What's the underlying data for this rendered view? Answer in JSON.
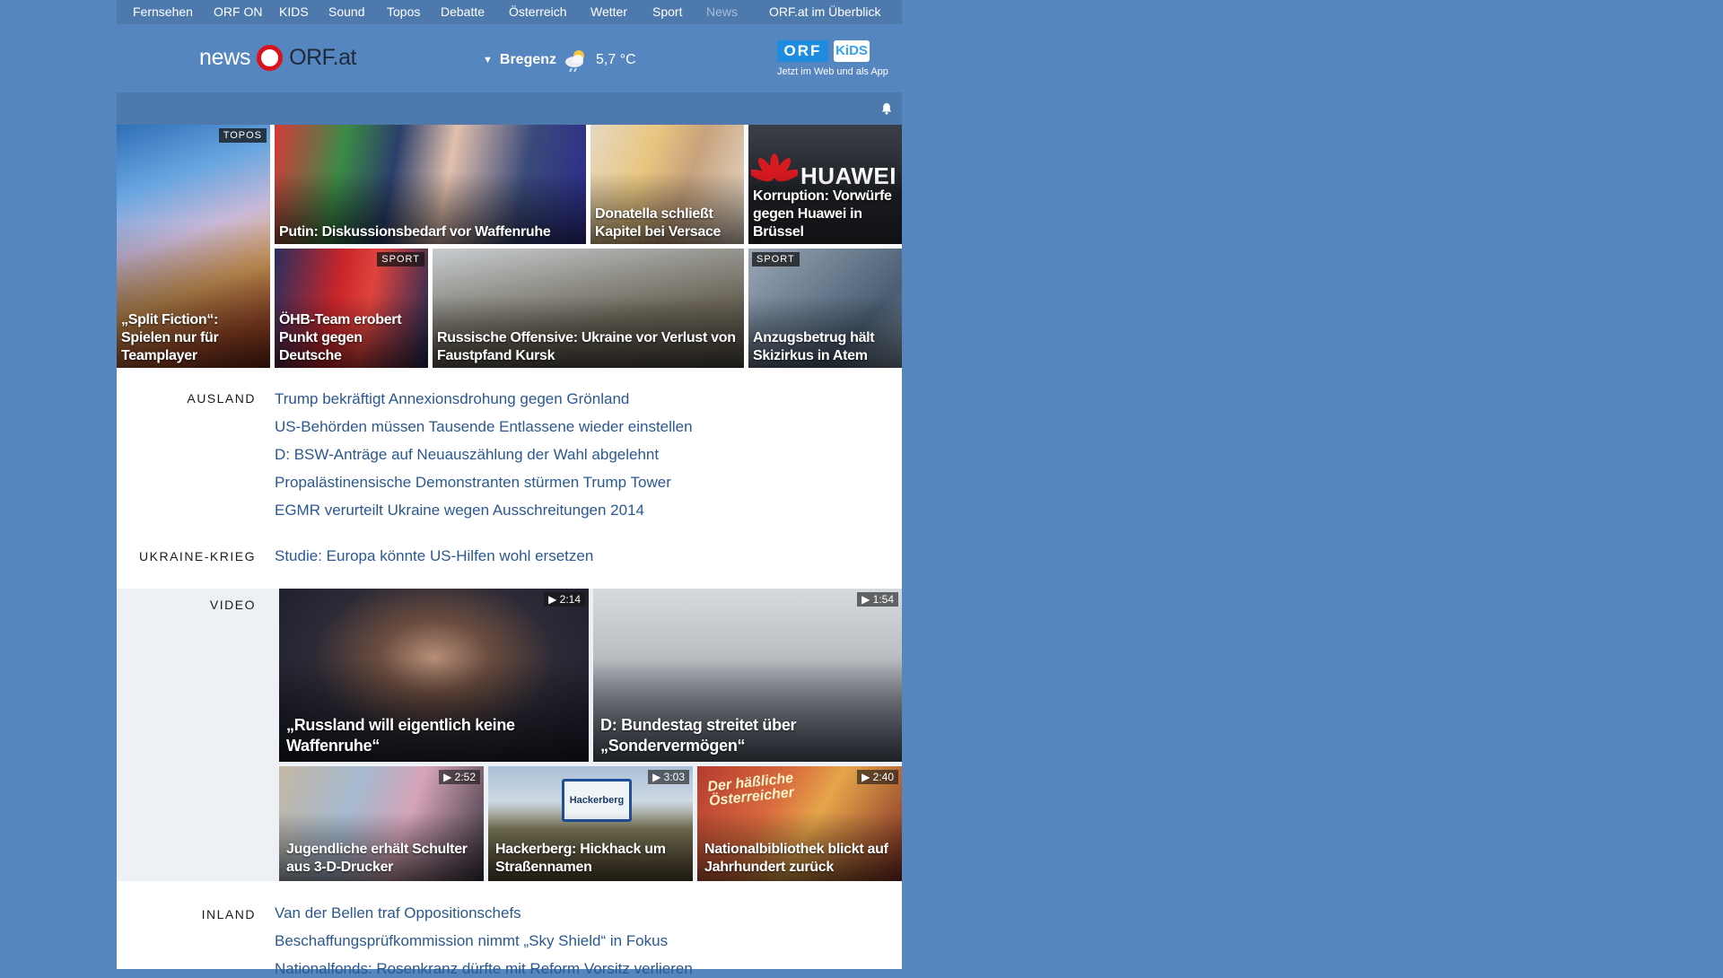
{
  "topnav": {
    "items": [
      "Fernsehen",
      "ORF ON",
      "KIDS",
      "Sound",
      "Topos",
      "Debatte",
      "Österreich",
      "Wetter",
      "Sport",
      "News"
    ],
    "current": "News",
    "overview": "ORF.at im Überblick"
  },
  "header": {
    "logo_news": "news",
    "logo_orf": "ORF.at",
    "weather": {
      "city": "Bregenz",
      "temp": "5,7 °C",
      "icon": "cloud-rain-sun-icon"
    },
    "kids": {
      "orf": "ORF",
      "kids": "KiDS",
      "tagline": "Jetzt im Web und als App"
    }
  },
  "teasers": [
    {
      "caption": "„Split Fiction“: Spielen nur für Teamplayer",
      "badge": "TOPOS"
    },
    {
      "caption": "Putin: Diskussionsbedarf vor Waffenruhe",
      "badge": ""
    },
    {
      "caption": "Donatella schließt Kapitel bei Versace",
      "badge": ""
    },
    {
      "caption": "Korruption: Vorwürfe gegen Huawei in Brüssel",
      "badge": "",
      "brand": "HUAWEI"
    },
    {
      "caption": "ÖHB-Team erobert Punkt gegen Deutsche",
      "badge": "SPORT"
    },
    {
      "caption": "Russische Offensive: Ukraine vor Verlust von Faustpfand Kursk",
      "badge": ""
    },
    {
      "caption": "Anzugsbetrug hält Skizirkus in Atem",
      "badge": "SPORT"
    }
  ],
  "ausland": {
    "label": "AUSLAND",
    "stories": [
      "Trump bekräftigt Annexionsdrohung gegen Grönland",
      "US-Behörden müssen Tausende Entlassene wieder einstellen",
      "D: BSW-Anträge auf Neuauszählung der Wahl abgelehnt",
      "Propalästinensische Demonstranten stürmen Trump Tower",
      "EGMR verurteilt Ukraine wegen Ausschreitungen 2014"
    ]
  },
  "ukraine": {
    "label": "UKRAINE-KRIEG",
    "stories": [
      "Studie: Europa könnte US-Hilfen wohl ersetzen"
    ]
  },
  "video": {
    "label": "VIDEO",
    "items": [
      {
        "caption": "„Russland will eigentlich keine Waffenruhe“",
        "duration": "2:14"
      },
      {
        "caption": "D: Bundestag streitet über „Sondervermögen“",
        "duration": "1:54"
      },
      {
        "caption": "Jugendliche erhält Schulter aus 3-D-Drucker",
        "duration": "2:52"
      },
      {
        "caption": "Hackerberg: Hickhack um Straßennamen",
        "duration": "3:03",
        "sign": "Hackerberg"
      },
      {
        "caption": "Nationalbibliothek blickt auf Jahrhundert zurück",
        "duration": "2:40",
        "poster": "Der häßliche Österreicher"
      }
    ]
  },
  "inland": {
    "label": "INLAND",
    "stories": [
      "Van der Bellen traf Oppositionschefs",
      "Beschaffungsprüfkommission nimmt „Sky Shield“ in Fokus",
      "Nationalfonds: Rosenkranz dürfte mit Reform Vorsitz verlieren"
    ]
  },
  "colors": {
    "background": "#5686c0",
    "nav": "#4e79ad",
    "link": "#2b5891",
    "accent_red": "#d9131c"
  }
}
